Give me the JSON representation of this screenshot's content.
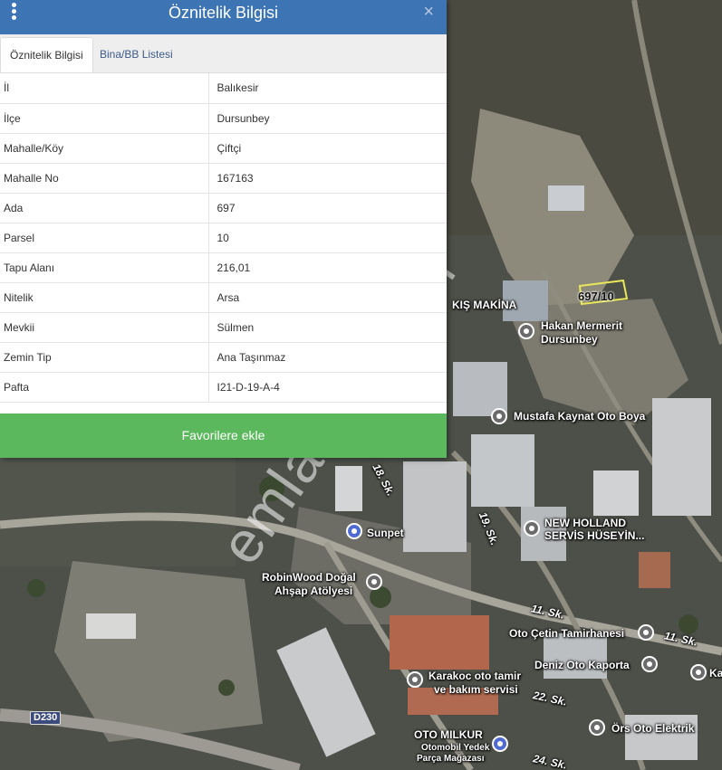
{
  "panel": {
    "title": "Öznitelik Bilgisi",
    "close_glyph": "×",
    "tabs": [
      {
        "label": "Öznitelik Bilgisi",
        "active": true
      },
      {
        "label": "Bina/BB Listesi",
        "active": false
      }
    ],
    "rows": [
      {
        "key": "İl",
        "value": "Balıkesir"
      },
      {
        "key": "İlçe",
        "value": "Dursunbey"
      },
      {
        "key": "Mahalle/Köy",
        "value": "Çiftçi"
      },
      {
        "key": "Mahalle No",
        "value": "167163"
      },
      {
        "key": "Ada",
        "value": "697"
      },
      {
        "key": "Parsel",
        "value": "10"
      },
      {
        "key": "Tapu Alanı",
        "value": "216,01"
      },
      {
        "key": "Nitelik",
        "value": "Arsa"
      },
      {
        "key": "Mevkii",
        "value": "Sülmen"
      },
      {
        "key": "Zemin Tip",
        "value": "Ana Taşınmaz"
      },
      {
        "key": "Pafta",
        "value": "I21-D-19-A-4"
      }
    ],
    "favorite_button": "Favorilere ekle",
    "colors": {
      "header": "#3d74b4",
      "button": "#5cb85c"
    }
  },
  "map": {
    "parcel_label": "697/10",
    "watermark": "emlakjet.com",
    "road_shield": "D230",
    "pois": {
      "kis_makina": "KIŞ MAKİNA",
      "hakan_line1": "Hakan Mermerit",
      "hakan_line2": "Dursunbey",
      "mustafa": "Mustafa Kaynat Oto Boya",
      "new_holland_line1": "NEW HOLLAND",
      "new_holland_line2": "SERVİS HÜSEYİN...",
      "sunpet": "Sunpet",
      "robinwood_line1": "RobinWood Doğal",
      "robinwood_line2": "Ahşap Atölyesi",
      "oto_cetin": "Oto Çetin Tamirhanesi",
      "deniz": "Deniz Oto Kaporta",
      "karakoc_line1": "Karakoc oto tamir",
      "karakoc_line2": "ve bakım servisi",
      "ors": "Örs Oto Elektrik",
      "oto_milkur_line1": "OTO MILKUR",
      "oto_milkur_line2": "Otomobil Yedek",
      "oto_milkur_line3": "Parça Mağazası",
      "ka": "Ka"
    },
    "streets": {
      "s18": "18. Sk.",
      "s19": "19. Sk.",
      "s11a": "11. Sk.",
      "s11b": "11. Sk.",
      "s22": "22. Sk.",
      "s24": "24. Sk."
    }
  }
}
